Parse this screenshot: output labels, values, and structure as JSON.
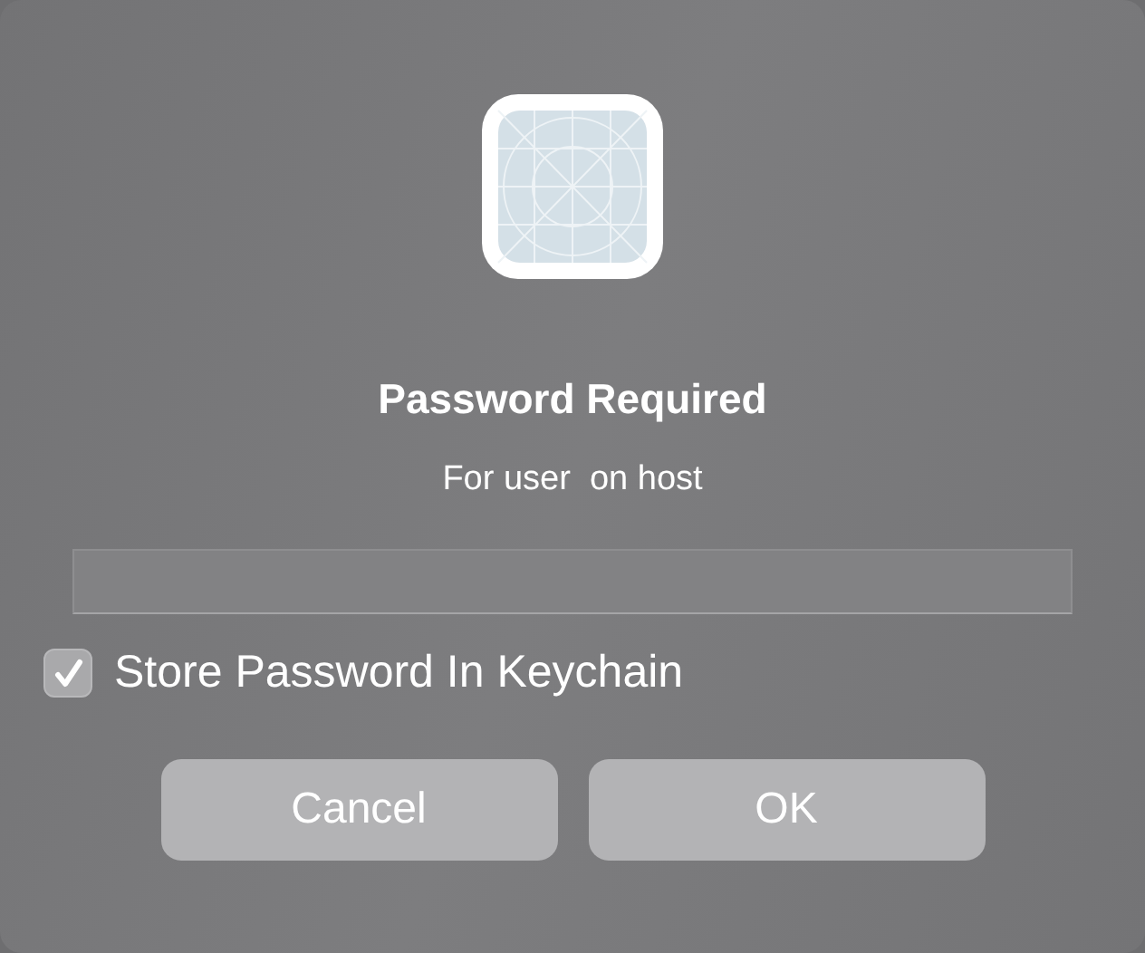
{
  "dialog": {
    "title": "Password Required",
    "message": "For user  on host",
    "store_in_keychain": {
      "label": "Store Password In Keychain",
      "checked": true
    },
    "buttons": [
      {
        "label": "Cancel"
      },
      {
        "label": "OK"
      }
    ]
  }
}
